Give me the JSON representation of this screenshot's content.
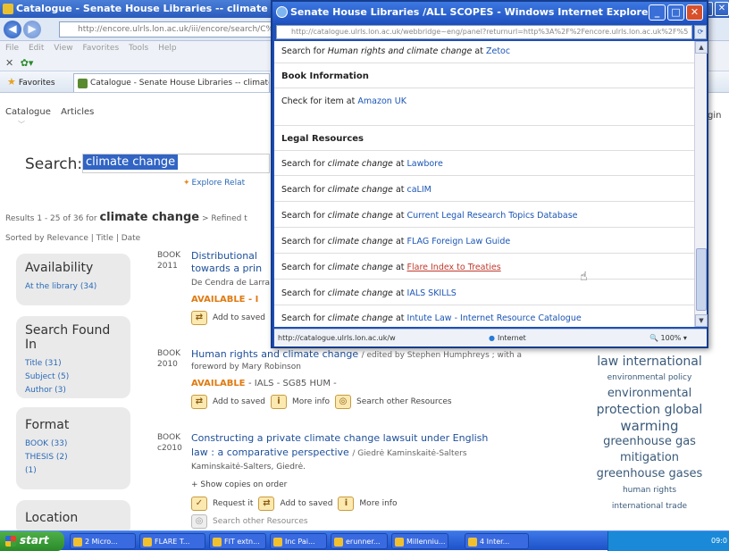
{
  "bg_window": {
    "title": "Catalogue - Senate House Libraries -- climate change -",
    "address": "http://encore.ulrls.lon.ac.uk/iii/encore/search/C%7C",
    "address_domain": "lon.ac.uk",
    "menu": [
      "File",
      "Edit",
      "View",
      "Favorites",
      "Tools",
      "Help"
    ],
    "favorites_label": "Favorites",
    "tab_label": "Catalogue - Senate House Libraries -- climate change"
  },
  "page": {
    "tabs": [
      "Catalogue",
      "Articles"
    ],
    "login": "gin",
    "search_label": "Search:",
    "search_value": "climate change",
    "explore": "Explore Relat",
    "results_prefix": "Results 1 - 25 of 36 for",
    "results_term": "climate change",
    "results_suffix": "> Refined t",
    "sorted": "Sorted by Relevance | Title | Date",
    "facets": [
      {
        "heading": "Availability",
        "items": [
          "At the library (34)"
        ]
      },
      {
        "heading": "Search Found In",
        "items": [
          "Title (31)",
          "Subject (5)",
          "Author (3)"
        ]
      },
      {
        "heading": "Format",
        "items": [
          "BOOK (33)",
          "THESIS (2)",
          "(1)"
        ]
      },
      {
        "heading": "Location",
        "items": []
      }
    ],
    "records": [
      {
        "type": "BOOK",
        "year": "2011",
        "title": "Distributional",
        "title2": "towards a prin",
        "author": "De Cendra de Larra",
        "avail": "AVAILABLE - I",
        "action_save": "Add to saved"
      },
      {
        "type": "BOOK",
        "year": "2010",
        "title": "Human rights and climate change",
        "by": "/ edited by Stephen Humphreys ; with a",
        "author": "foreword by Mary Robinson",
        "avail": "AVAILABLE",
        "avail_rest": "- IALS - SG85 HUM -",
        "action_save": "Add to saved",
        "action_info": "More info",
        "action_search": "Search other Resources"
      },
      {
        "type": "BOOK",
        "year": "c2010",
        "title": "Constructing a private climate change lawsuit under English",
        "title2": "law : a comparative perspective",
        "by": "/ Giedrė Kaminskaitė-Salters",
        "author": "Kaminskaitė-Salters, Giedrė.",
        "show_copies": "+ Show copies on order",
        "action_request": "Request it",
        "action_save": "Add to saved",
        "action_info": "More info",
        "action_search": "Search other Resources"
      }
    ],
    "cloud": [
      "law international",
      "environmental policy",
      "environmental",
      "protection global",
      "warming",
      "greenhouse gas",
      "mitigation",
      "greenhouse gases",
      "human rights",
      "international trade"
    ]
  },
  "popup": {
    "title": "Senate House Libraries /ALL SCOPES - Windows Internet Explorer",
    "address": "http://catalogue.ulrls.lon.ac.uk/webbridge~eng/panel?returnurl=http%3A%2F%2Fencore.ulrls.lon.ac.uk%2F%5",
    "address_domain": "lon.ac.uk",
    "top_line": {
      "prefix": "Search for",
      "term": "Human rights and climate change",
      "mid": "at",
      "link": "Zetoc"
    },
    "sections": [
      {
        "heading": "Book Information",
        "lines": [
          {
            "prefix": "Check for item at",
            "link": "Amazon UK"
          }
        ]
      },
      {
        "heading": "Legal Resources",
        "lines": [
          {
            "prefix": "Search for",
            "term": "climate change",
            "mid": "at",
            "link": "Lawbore"
          },
          {
            "prefix": "Search for",
            "term": "climate change",
            "mid": "at",
            "link": "caLIM"
          },
          {
            "prefix": "Search for",
            "term": "climate change",
            "mid": "at",
            "link": "Current Legal Research Topics Database"
          },
          {
            "prefix": "Search for",
            "term": "climate change",
            "mid": "at",
            "link": "FLAG Foreign Law Guide"
          },
          {
            "prefix": "Search for",
            "term": "climate change",
            "mid": "at",
            "link": "Flare Index to Treaties"
          },
          {
            "prefix": "Search for",
            "term": "climate change",
            "mid": "at",
            "link": "IALS SKILLS"
          },
          {
            "prefix": "Search for",
            "term": "climate change",
            "mid": "at",
            "link": "Intute Law - Internet Resource Catalogue"
          }
        ]
      }
    ],
    "status_url": "http://catalogue.ulrls.lon.ac.uk/w",
    "status_zone": "Internet",
    "status_zoom": "100%"
  },
  "taskbar": {
    "start": "start",
    "buttons": [
      "2 Micro...",
      "FLARE T...",
      "FIT extn...",
      "Inc Pai...",
      "erunner...",
      "Millenniu...",
      "4 Inter..."
    ],
    "clock": "09:0"
  }
}
